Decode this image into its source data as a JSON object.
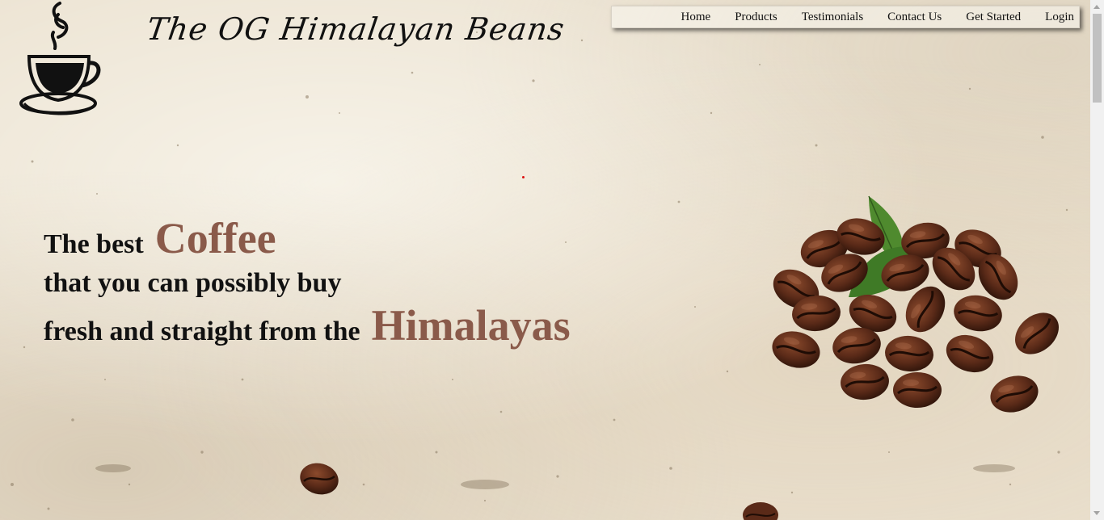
{
  "brand": {
    "title": "The OG Himalayan Beans",
    "logo_icon": "coffee-cup-icon"
  },
  "nav": {
    "items": [
      {
        "label": "Home"
      },
      {
        "label": "Products"
      },
      {
        "label": "Testimonials"
      },
      {
        "label": "Contact Us"
      },
      {
        "label": "Get Started"
      },
      {
        "label": "Login"
      }
    ]
  },
  "hero": {
    "line1_text": "The best",
    "line1_accent": "Coffee",
    "line2_text": "that you can possibly buy",
    "line3_text": "fresh and straight from the",
    "line3_accent": "Himalayas"
  },
  "colors": {
    "accent": "#8a5a4a",
    "text": "#111111",
    "background": "#ece3d2",
    "bean": "#5a2a18",
    "leaf": "#4f8a2e"
  },
  "images": {
    "beans_pile": "coffee-beans-image",
    "loose_bean": "coffee-bean-icon"
  }
}
